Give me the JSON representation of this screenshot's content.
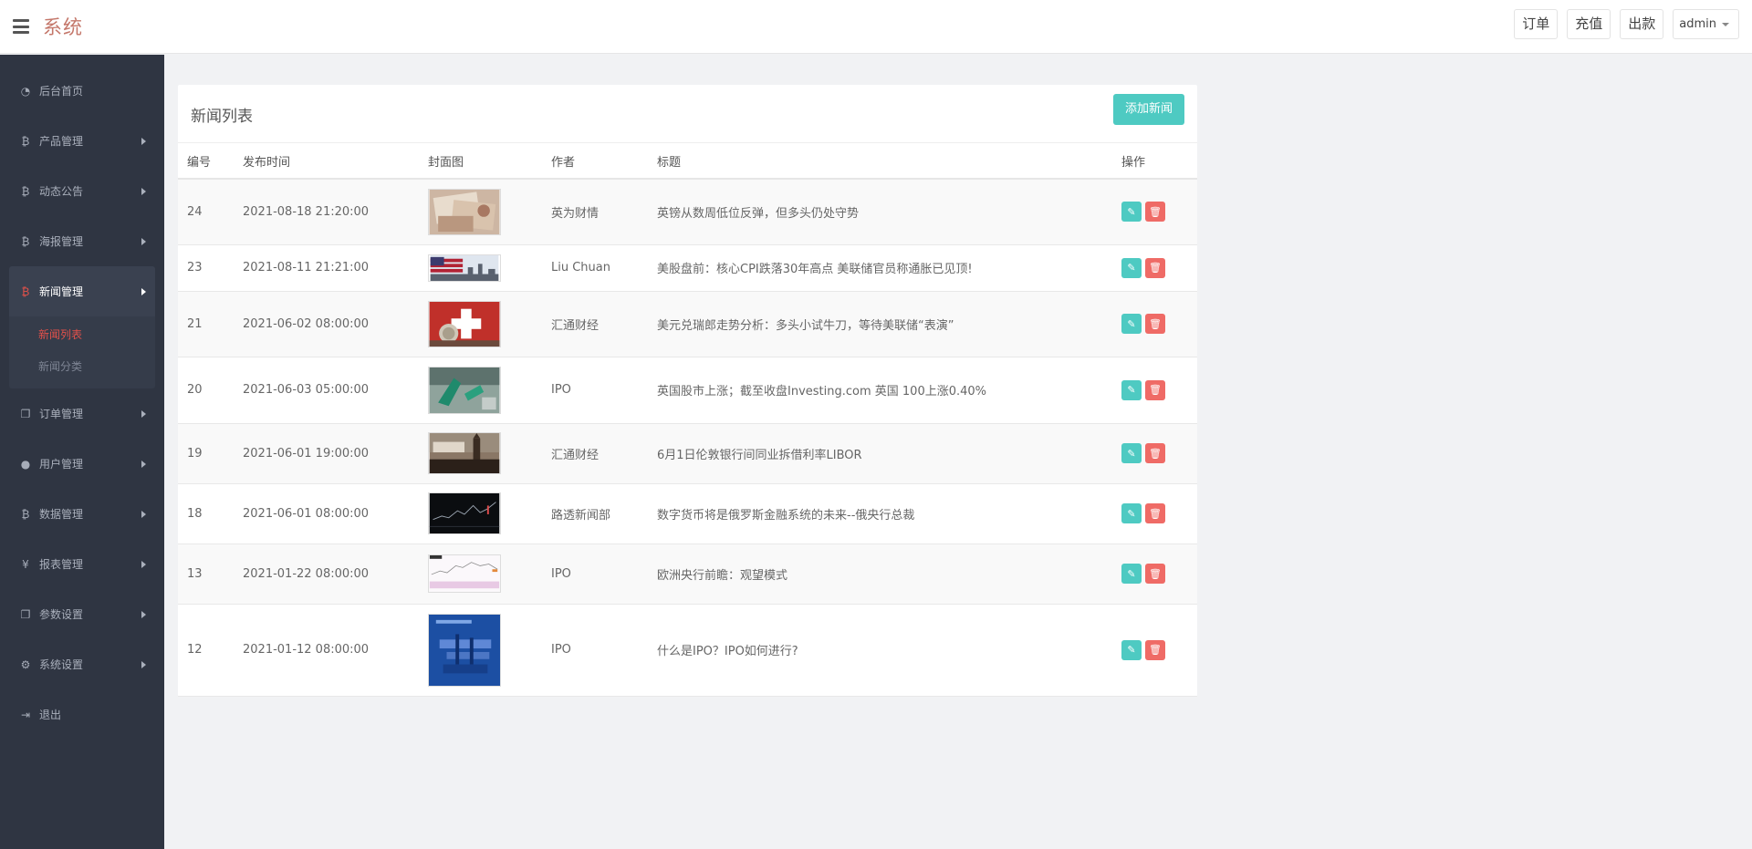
{
  "header": {
    "brand": "系统",
    "buttons": [
      "订单",
      "充值",
      "出款"
    ],
    "user": "admin"
  },
  "sidebar": {
    "items": [
      {
        "label": "后台首页",
        "icon": "dashboard-icon"
      },
      {
        "label": "产品管理",
        "icon": "bitcoin-icon"
      },
      {
        "label": "动态公告",
        "icon": "bitcoin-icon"
      },
      {
        "label": "海报管理",
        "icon": "bitcoin-icon"
      },
      {
        "label": "新闻管理",
        "icon": "bitcoin-icon"
      },
      {
        "label": "订单管理",
        "icon": "copy-icon"
      },
      {
        "label": "用户管理",
        "icon": "user-icon"
      },
      {
        "label": "数据管理",
        "icon": "bitcoin-icon"
      },
      {
        "label": "报表管理",
        "icon": "yen-icon"
      },
      {
        "label": "参数设置",
        "icon": "copy-icon"
      },
      {
        "label": "系统设置",
        "icon": "gears-icon"
      },
      {
        "label": "退出",
        "icon": "sign-out-icon"
      }
    ],
    "submenu": [
      "新闻列表",
      "新闻分类"
    ]
  },
  "panel": {
    "title": "新闻列表",
    "add_button": "添加新闻",
    "columns": [
      "编号",
      "发布时间",
      "封面图",
      "作者",
      "标题",
      "操作"
    ],
    "rows": [
      {
        "id": "24",
        "time": "2021-08-18 21:20:00",
        "author": "英为财情",
        "title": "英镑从数周低位反弹，但多头仍处守势"
      },
      {
        "id": "23",
        "time": "2021-08-11 21:21:00",
        "author": "Liu Chuan",
        "title": "美股盘前：核心CPI跌落30年高点 美联储官员称通胀已见顶!"
      },
      {
        "id": "21",
        "time": "2021-06-02 08:00:00",
        "author": "汇通财经",
        "title": "美元兑瑞郎走势分析：多头小试牛刀，等待美联储“表演”"
      },
      {
        "id": "20",
        "time": "2021-06-03 05:00:00",
        "author": "IPO",
        "title": "英国股市上涨；截至收盘Investing.com 英国 100上涨0.40%"
      },
      {
        "id": "19",
        "time": "2021-06-01 19:00:00",
        "author": "汇通财经",
        "title": "6月1日伦敦银行间同业拆借利率LIBOR"
      },
      {
        "id": "18",
        "time": "2021-06-01 08:00:00",
        "author": "路透新闻部",
        "title": "数字货币将是俄罗斯金融系统的未来--俄央行总裁"
      },
      {
        "id": "13",
        "time": "2021-01-22 08:00:00",
        "author": "IPO",
        "title": "欧洲央行前瞻：观望模式"
      },
      {
        "id": "12",
        "time": "2021-01-12 08:00:00",
        "author": "IPO",
        "title": "什么是IPO？IPO如何进行?"
      }
    ]
  }
}
